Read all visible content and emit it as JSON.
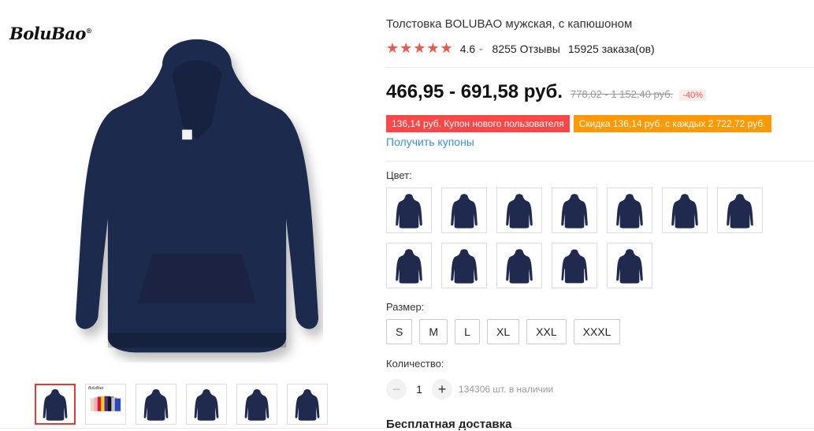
{
  "gallery": {
    "brand_logo": "BoluBao",
    "main_image": {
      "color": "#1f2a4e",
      "icon": "hoodie-image"
    },
    "thumbnails": [
      {
        "color": "#1f2a4e",
        "active": true
      },
      {
        "color": "multi",
        "active": false,
        "label": "BoluBao"
      },
      {
        "color": "#151515",
        "active": false
      },
      {
        "color": "#2a46c9",
        "active": false
      },
      {
        "color": "#c4c4c6",
        "active": false
      },
      {
        "color": "#666a70",
        "active": false
      }
    ]
  },
  "product": {
    "title": "Толстовка BOLUBAO мужская, с капюшоном",
    "stars": "★★★★★",
    "rating": "4.6",
    "reviews": "8255 Отзывы",
    "orders": "15925 заказа(ов)",
    "price": "466,95 - 691,58 руб.",
    "old_price": "778,02 - 1 152,40 руб.",
    "discount": "-40%",
    "coupon_new_user": "136,14 руб. Купон нового пользователя",
    "coupon_discount": "Скидка 136,14 руб. с каждых 2 722,72 руб.",
    "get_coupons": "Получить купоны",
    "color_label": "Цвет:",
    "colors": [
      "#151515",
      "#2a46c9",
      "#666a70",
      "#eed9b8",
      "#c4c4c6",
      "#1f2a4e",
      "#f0601c",
      "#f1aac4",
      "#4d2c8f",
      "#d81f28",
      "#f4f4f6",
      "#f3cf17"
    ],
    "size_label": "Размер:",
    "sizes": [
      "S",
      "M",
      "L",
      "XL",
      "XXL",
      "XXXL"
    ],
    "quantity_label": "Количество:",
    "quantity": "1",
    "minus": "−",
    "plus": "+",
    "stock": "134306 шт. в наличии",
    "shipping": "Бесплатная доставка"
  },
  "theme": {
    "accent_red": "#ff4747",
    "accent_orange": "#ff9900",
    "link_blue": "#3a8fd9"
  }
}
